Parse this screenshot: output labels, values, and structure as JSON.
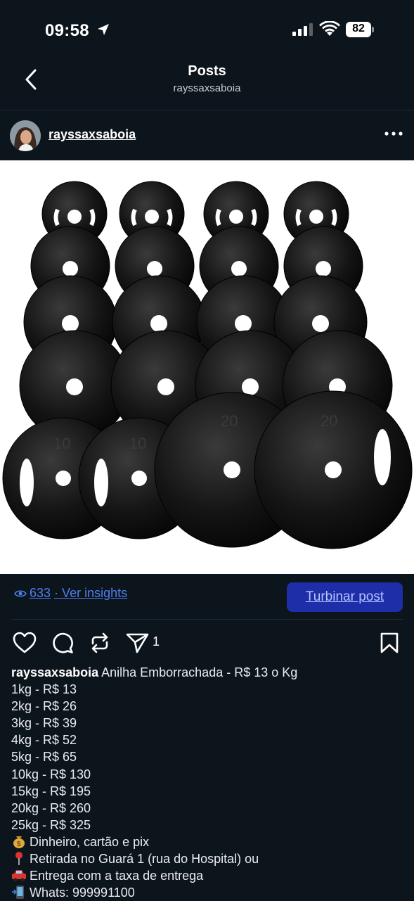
{
  "status_bar": {
    "time": "09:58",
    "battery": "82"
  },
  "nav": {
    "title": "Posts",
    "subtitle": "rayssaxsaboia"
  },
  "post": {
    "username": "rayssaxsaboia",
    "plate_labels": [
      "10",
      "10",
      "20",
      "20"
    ],
    "views": "633",
    "insights_link": "· Ver insights",
    "boost_label": "Turbinar post",
    "share_count": "1"
  },
  "caption": {
    "username": "rayssaxsaboia",
    "first_line": "Anilha Emborrachada - R$ 13 o Kg",
    "lines": [
      "1kg - R$ 13",
      "2kg - R$ 26",
      "3kg - R$ 39",
      "4kg - R$ 52",
      "5kg - R$ 65",
      "10kg - R$ 130",
      "15kg - R$ 195",
      "20kg - R$ 260",
      "25kg - R$ 325"
    ],
    "payment": "Dinheiro, cartão e pix",
    "pickup": "Retirada no Guará 1 (rua do Hospital) ou",
    "delivery": "Entrega com a taxa de entrega",
    "whatsapp": "Whats: 999991100"
  },
  "icons": {
    "back": "chevron-left-icon",
    "more": "more-horizontal-icon",
    "like": "heart-icon",
    "comment": "comment-icon",
    "repost": "repost-icon",
    "share": "send-icon",
    "save": "bookmark-icon",
    "views": "eye-icon"
  },
  "colors": {
    "background": "#0d151c",
    "link": "#4d7ff0",
    "boost": "#1d2ea8"
  }
}
